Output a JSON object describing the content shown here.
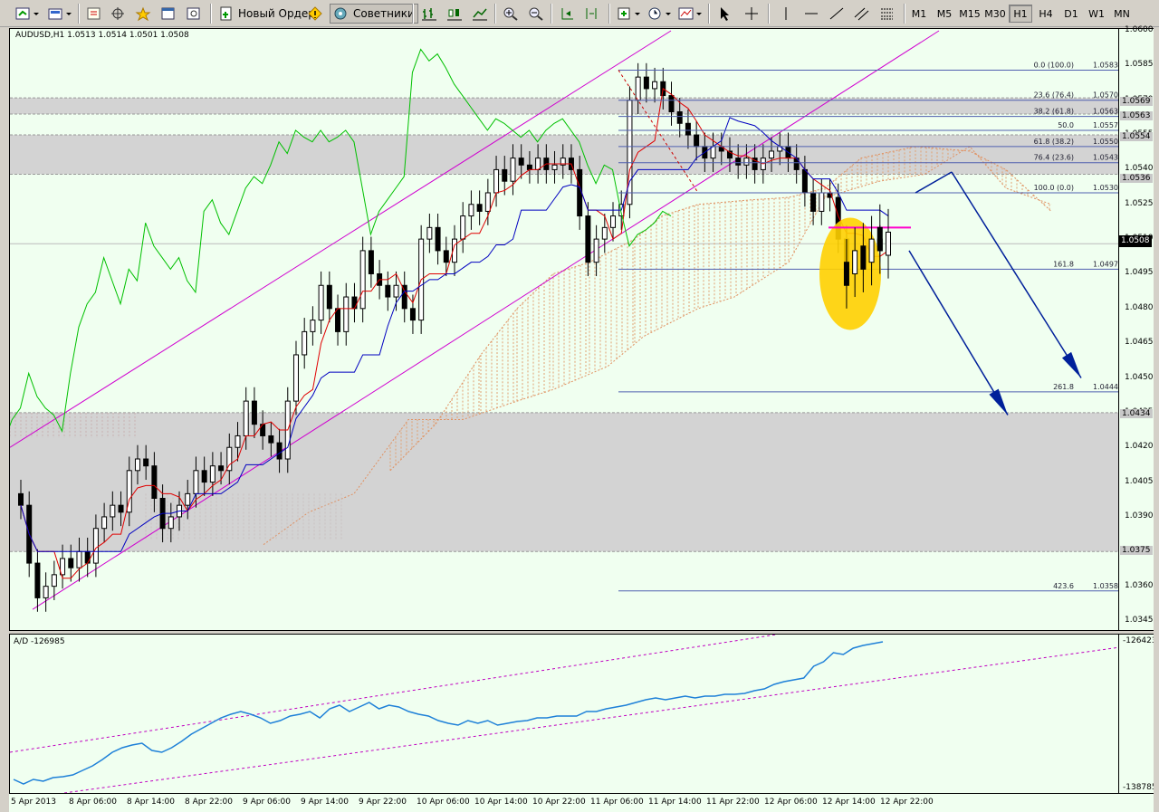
{
  "toolbar": {
    "new_order_label": "Новый Ордер",
    "advisors_label": "Советники",
    "timeframes": [
      "M1",
      "M5",
      "M15",
      "M30",
      "H1",
      "H4",
      "D1",
      "W1",
      "MN"
    ],
    "active_timeframe": "H1"
  },
  "chart": {
    "symbol_line": "AUDUSD,H1  1.0513 1.0514 1.0501 1.0508",
    "current_price": "1.0508",
    "y_ticks": [
      "1.0600",
      "1.0585",
      "1.0570",
      "1.0555",
      "1.0540",
      "1.0525",
      "1.0510",
      "1.0495",
      "1.0480",
      "1.0465",
      "1.0450",
      "1.0435",
      "1.0420",
      "1.0405",
      "1.0390",
      "1.0375",
      "1.0360",
      "1.0345"
    ],
    "zone_levels": [
      "1.0569",
      "1.0563",
      "1.0554",
      "1.0536",
      "1.0434",
      "1.0375"
    ],
    "fib": [
      {
        "label": "0.0 (100.0)",
        "price": "1.0583"
      },
      {
        "label": "23.6 (76.4)",
        "price": "1.0570"
      },
      {
        "label": "38.2 (61.8)",
        "price": "1.0563"
      },
      {
        "label": "50.0",
        "price": "1.0557"
      },
      {
        "label": "61.8 (38.2)",
        "price": "1.0550"
      },
      {
        "label": "76.4 (23.6)",
        "price": "1.0543"
      },
      {
        "label": "100.0 (0.0)",
        "price": "1.0530"
      },
      {
        "label": "161.8",
        "price": "1.0497"
      },
      {
        "label": "261.8",
        "price": "1.0444"
      },
      {
        "label": "423.6",
        "price": "1.0358"
      }
    ]
  },
  "indicator": {
    "label": "A/D -126985",
    "top_value": "-126423",
    "bottom_value": "-138785"
  },
  "x_ticks": [
    "5 Apr 2013",
    "8 Apr 06:00",
    "8 Apr 14:00",
    "8 Apr 22:00",
    "9 Apr 06:00",
    "9 Apr 14:00",
    "9 Apr 22:00",
    "10 Apr 06:00",
    "10 Apr 14:00",
    "10 Apr 22:00",
    "11 Apr 06:00",
    "11 Apr 14:00",
    "11 Apr 22:00",
    "12 Apr 06:00",
    "12 Apr 14:00",
    "12 Apr 22:00"
  ],
  "colors": {
    "bg": "#f0fff0",
    "tenkan": "#e00000",
    "kijun": "#0000c0",
    "chikou": "#00c000",
    "channel": "#d000d0",
    "zone": "#d3d3d3",
    "ellipse": "#ffd000",
    "arrows": "#00209a"
  }
}
